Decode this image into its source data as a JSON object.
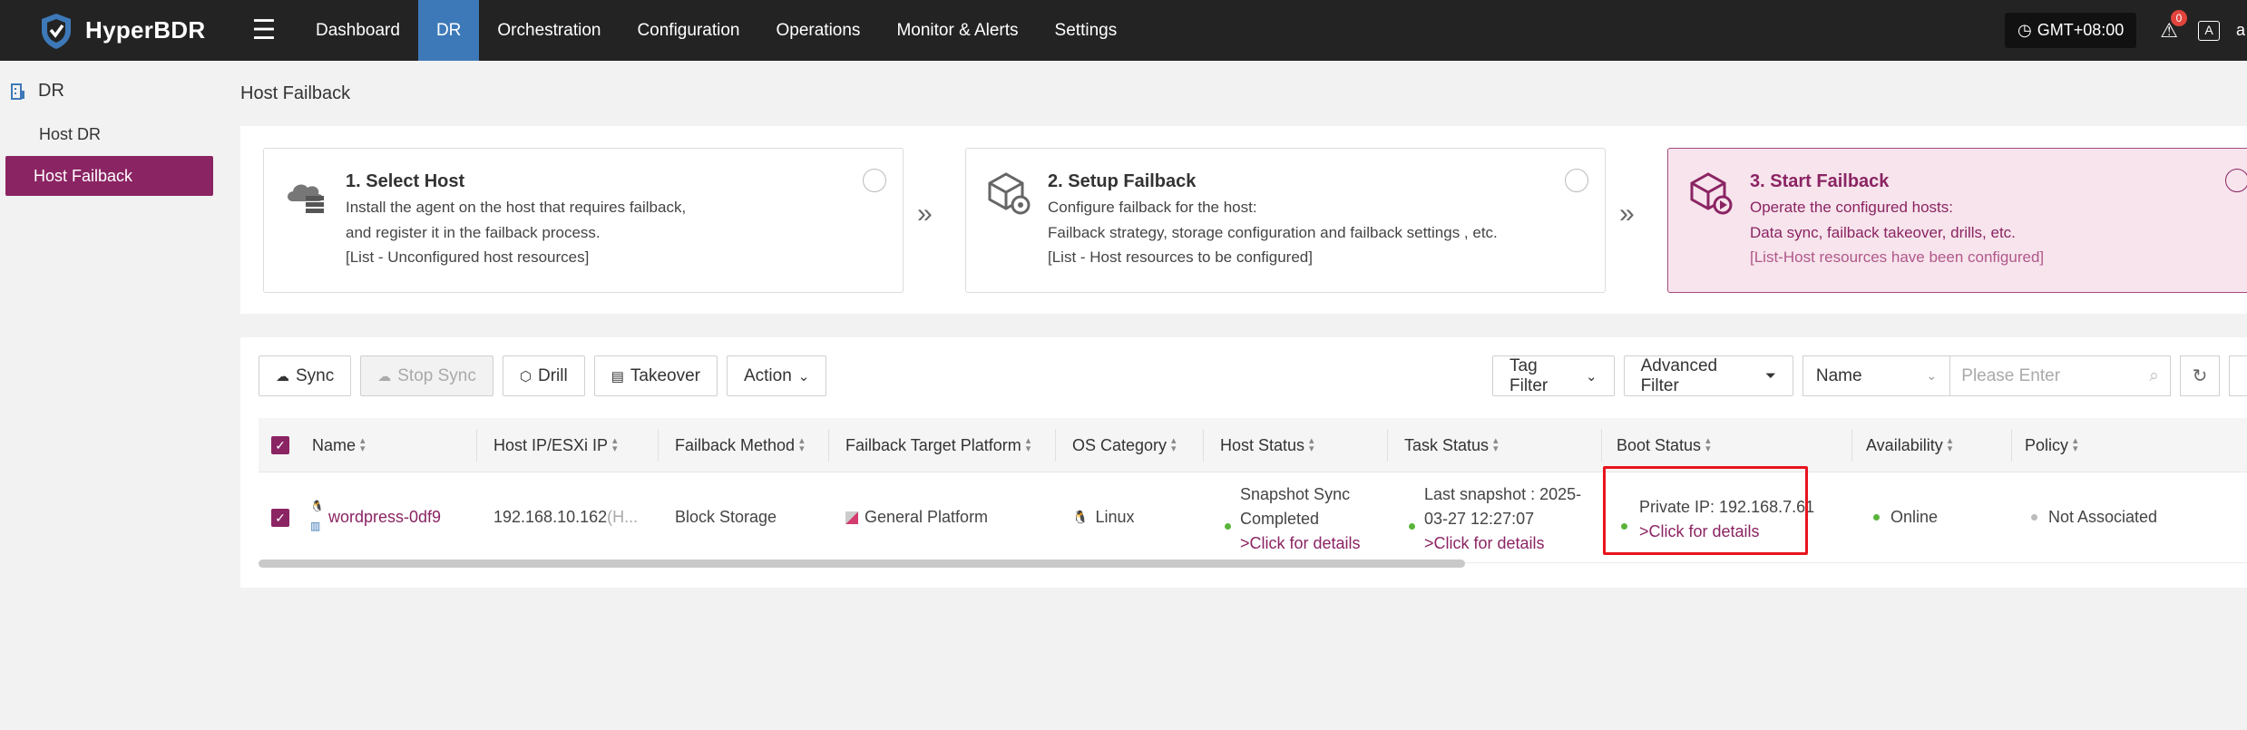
{
  "app": {
    "name": "HyperBDR"
  },
  "nav": {
    "items": [
      "Dashboard",
      "DR",
      "Orchestration",
      "Configuration",
      "Operations",
      "Monitor & Alerts",
      "Settings"
    ],
    "active": "DR"
  },
  "header": {
    "timezone": "GMT+08:00",
    "alert_count": "0",
    "lang_icon": "language-icon",
    "user_initial": "a"
  },
  "sidebar": {
    "section": "DR",
    "items": [
      {
        "label": "Host DR",
        "active": false
      },
      {
        "label": "Host Failback",
        "active": true
      }
    ]
  },
  "page": {
    "title": "Host Failback"
  },
  "steps": [
    {
      "title": "1. Select Host",
      "line1": "Install the agent on the host that requires failback,",
      "line2": "and register it in the failback process.",
      "line3": "[List - Unconfigured host resources]"
    },
    {
      "title": "2. Setup Failback",
      "line1": "Configure failback for the host:",
      "line2": "Failback strategy, storage configuration and failback settings , etc.",
      "line3": "[List - Host resources to be configured]"
    },
    {
      "title": "3. Start Failback",
      "line1": "Operate the configured hosts:",
      "line2": "Data sync, failback takeover, drills, etc.",
      "line3": "[List-Host resources have been configured]"
    }
  ],
  "toolbar": {
    "sync": "Sync",
    "stop_sync": "Stop Sync",
    "drill": "Drill",
    "takeover": "Takeover",
    "action": "Action",
    "tag_filter": "Tag Filter",
    "advanced_filter": "Advanced Filter",
    "search_field": "Name",
    "search_placeholder": "Please Enter"
  },
  "table": {
    "columns": [
      "Name",
      "Host IP/ESXi IP",
      "Failback Method",
      "Failback Target Platform",
      "OS Category",
      "Host Status",
      "Task Status",
      "Boot Status",
      "Availability",
      "Policy"
    ],
    "rows": [
      {
        "name": "wordpress-0df9",
        "host_ip": "192.168.10.162",
        "host_ip_suffix": "(H...",
        "failback_method": "Block Storage",
        "target_platform": "General Platform",
        "os_category": "Linux",
        "host_status_line1": "Snapshot Sync",
        "host_status_line2": "Completed",
        "host_status_link": ">Click for details",
        "task_status_line1": "Last snapshot : 2025-",
        "task_status_line2": "03-27 12:27:07",
        "task_status_link": ">Click for details",
        "boot_status": "Private IP: 192.168.7.61",
        "boot_status_link": ">Click for details",
        "availability": "Online",
        "policy": "Not Associated"
      }
    ]
  },
  "colors": {
    "brand": "#8b2463",
    "nav_active": "#3d79b8",
    "topbar": "#232323",
    "highlight": "#e8141e",
    "online": "#5ab43c"
  }
}
